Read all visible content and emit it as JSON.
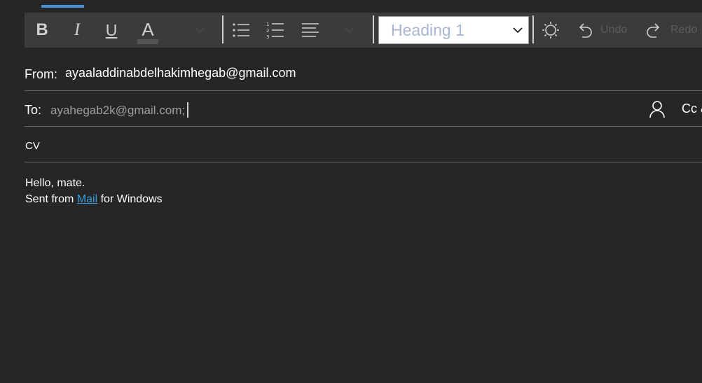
{
  "toolbar": {
    "bold_label": "B",
    "italic_label": "I",
    "underline_label": "U",
    "font_color_label": "A",
    "heading_select": {
      "value": "Heading 1"
    },
    "undo_label": "Undo",
    "redo_label": "Redo"
  },
  "header": {
    "from_label": "From:",
    "from_value": "ayaaladdinabdelhakimhegab@gmail.com",
    "to_label": "To:",
    "to_value": "ayahegab2k@gmail.com;",
    "cc_label": "Cc &"
  },
  "subject": {
    "value": "CV"
  },
  "body": {
    "line1": "Hello, mate.",
    "sent_from_prefix": "Sent from",
    "link_text": "Mail",
    "sent_from_suffix": "for Windows"
  },
  "colors": {
    "background": "#262626",
    "toolbar": "#3b3b3b",
    "accent": "#4a90d9",
    "link": "#3a9be0",
    "disabled_text": "#5c5c5c"
  },
  "icons": [
    "bold-icon",
    "italic-icon",
    "underline-icon",
    "font-color-icon",
    "bullets-icon",
    "numbering-icon",
    "align-left-icon",
    "chevron-down-icon",
    "theme-icon",
    "undo-icon",
    "redo-icon",
    "person-icon"
  ]
}
